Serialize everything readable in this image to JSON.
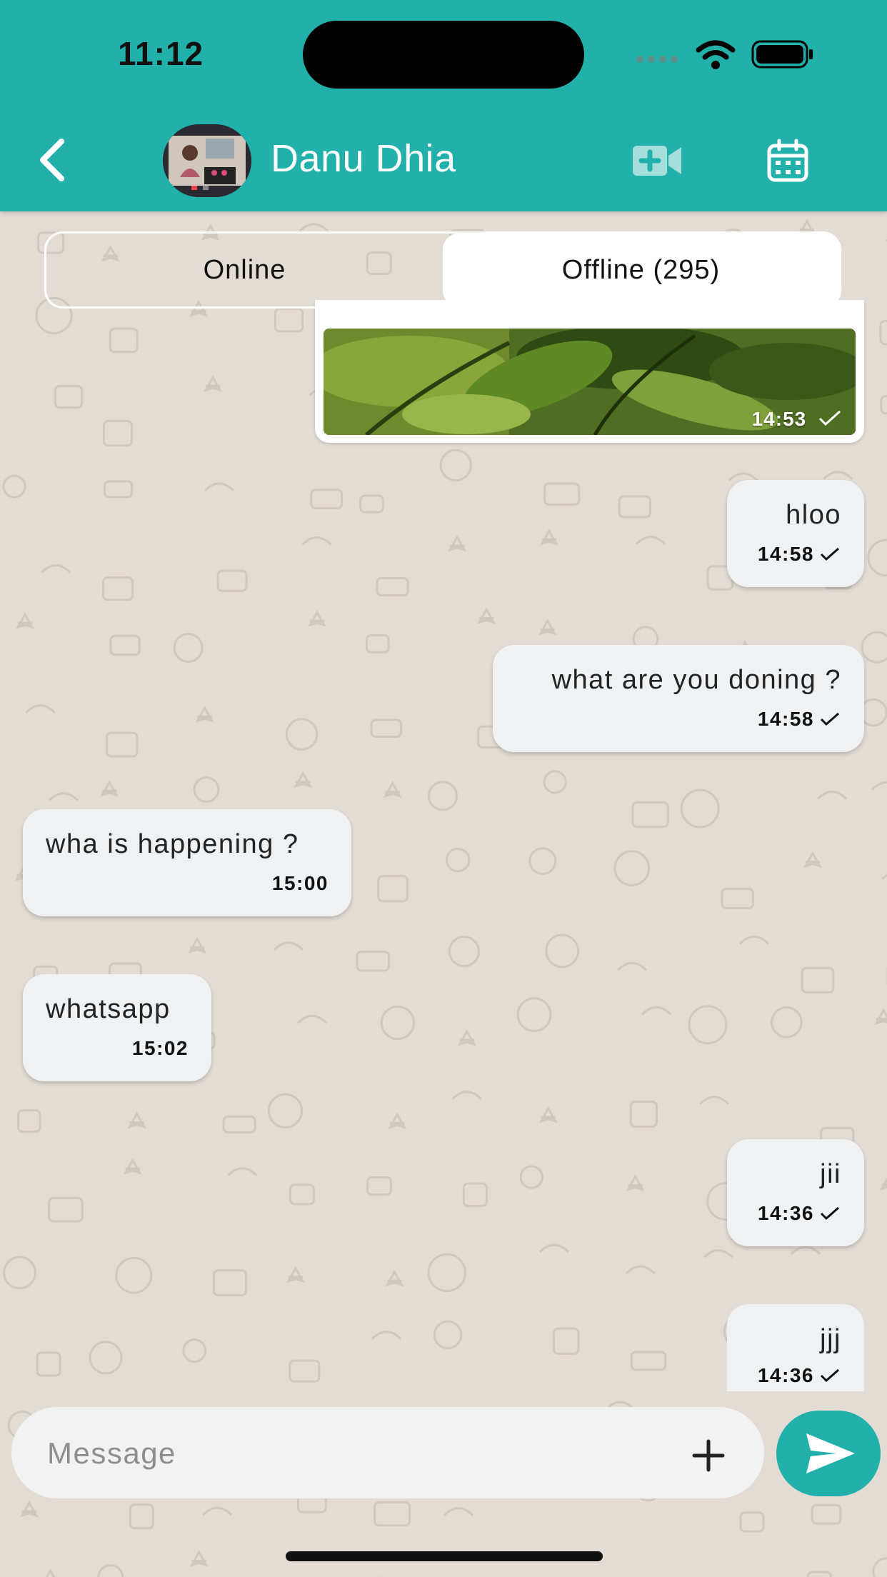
{
  "status_bar": {
    "time": "11:12"
  },
  "header": {
    "contact_name": "Danu Dhia",
    "back_icon": "chevron-left-icon",
    "video_icon": "video-add-icon",
    "calendar_icon": "calendar-icon",
    "color": "#21b0aa"
  },
  "tabs": {
    "online_label": "Online",
    "offline_label": "Offline (295)",
    "selected": "offline"
  },
  "messages": [
    {
      "type": "image",
      "direction": "out",
      "time": "14:53",
      "read": true
    },
    {
      "type": "text",
      "direction": "out",
      "text": "hloo",
      "time": "14:58",
      "read": true
    },
    {
      "type": "text",
      "direction": "out",
      "text": "what are you doning ?",
      "time": "14:58",
      "read": true
    },
    {
      "type": "text",
      "direction": "in",
      "text": "wha is happening ?",
      "time": "15:00"
    },
    {
      "type": "text",
      "direction": "in",
      "text": "whatsapp",
      "time": "15:02"
    },
    {
      "type": "text",
      "direction": "out",
      "text": "jii",
      "time": "14:36",
      "read": true
    },
    {
      "type": "text",
      "direction": "out",
      "text": "jjj",
      "time": "14:36",
      "read": true
    }
  ],
  "composer": {
    "placeholder": "Message",
    "value": "",
    "add_icon": "plus-icon",
    "send_icon": "send-icon"
  }
}
